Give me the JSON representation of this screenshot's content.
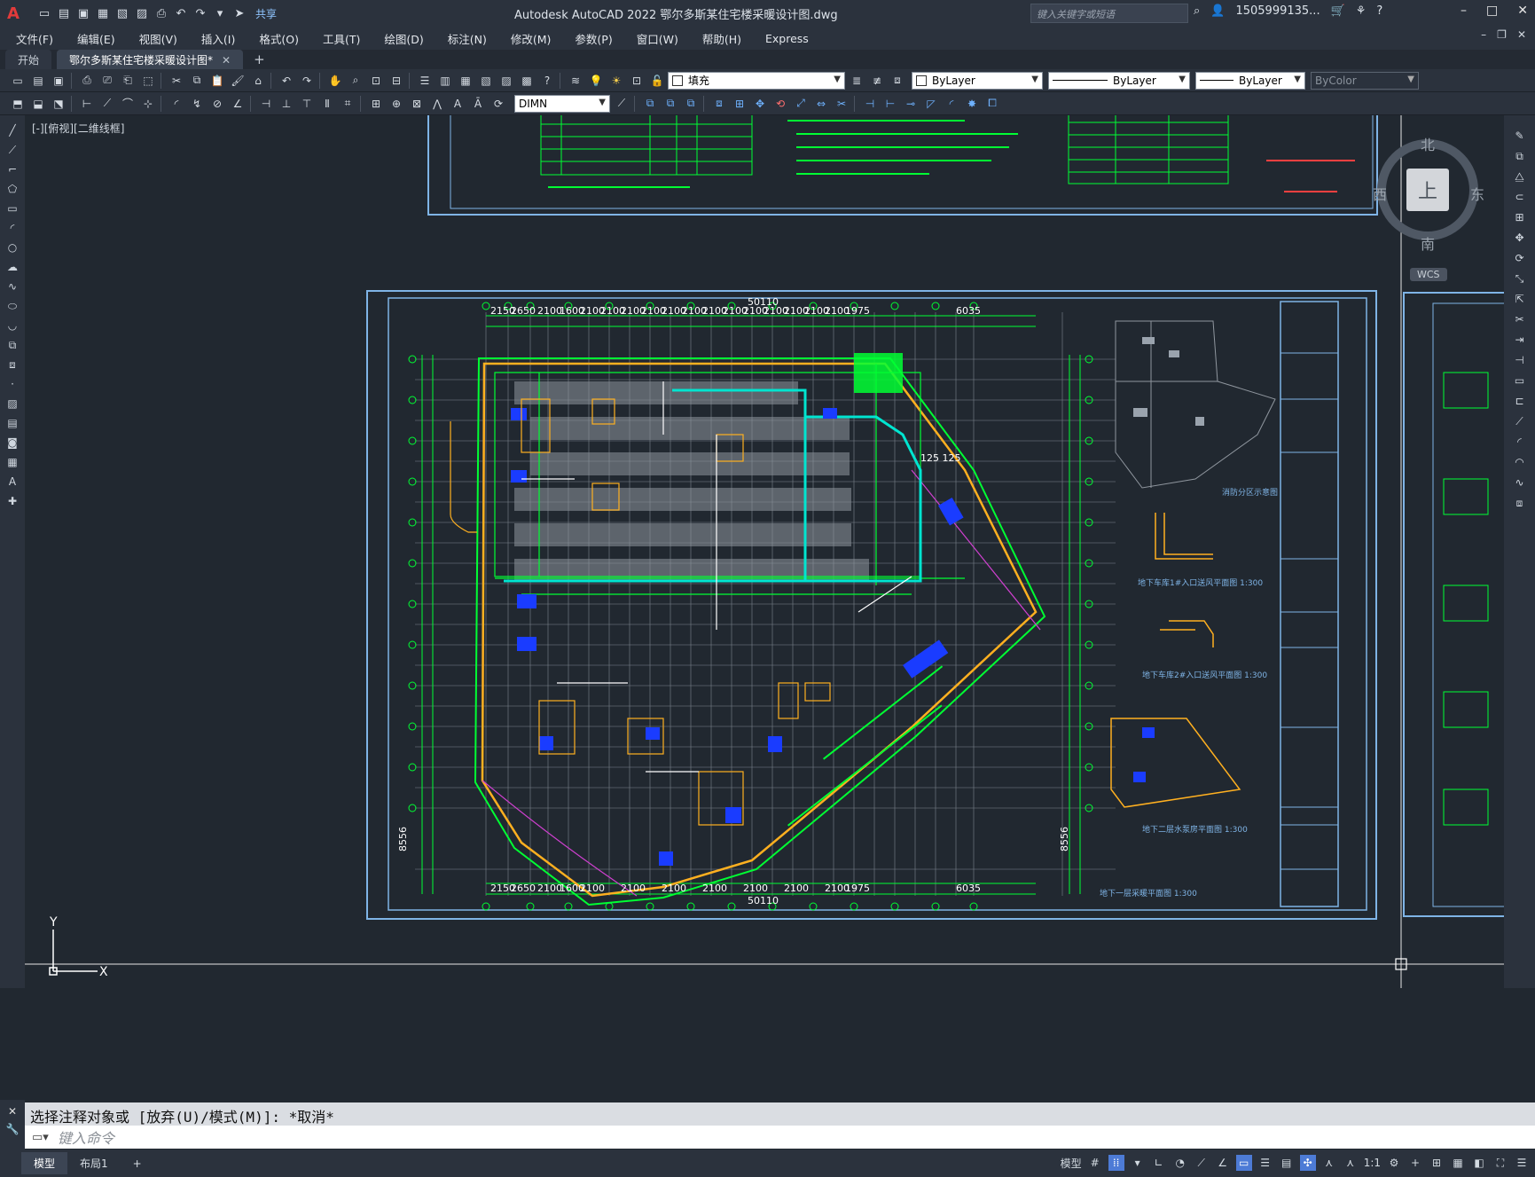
{
  "titlebar": {
    "app_logo": "A",
    "share_label": "共享",
    "title": "Autodesk AutoCAD 2022    鄂尔多斯某住宅楼采暖设计图.dwg",
    "search_placeholder": "键入关键字或短语",
    "user": "1505999135...",
    "controls": [
      "–",
      "□",
      "✕"
    ]
  },
  "menu": {
    "items": [
      "文件(F)",
      "编辑(E)",
      "视图(V)",
      "插入(I)",
      "格式(O)",
      "工具(T)",
      "绘图(D)",
      "标注(N)",
      "修改(M)",
      "参数(P)",
      "窗口(W)",
      "帮助(H)",
      "Express"
    ]
  },
  "tabs": {
    "items": [
      {
        "label": "开始"
      },
      {
        "label": "鄂尔多斯某住宅楼采暖设计图*"
      }
    ],
    "close": "✕",
    "add": "+"
  },
  "properties": {
    "layer": "填充",
    "color": "ByLayer",
    "linetype": "ByLayer",
    "lineweight": "ByLayer",
    "plotstyle": "ByColor",
    "dimstyle": "DIMN"
  },
  "viewport": {
    "label": "[-][俯视][二维线框]",
    "viewcube": {
      "north": "北",
      "south": "南",
      "east": "东",
      "west": "西",
      "top": "上"
    },
    "wcs": "WCS",
    "ucs_y": "Y",
    "ucs_x": "X"
  },
  "drawing_text": {
    "dims_top": [
      "2150",
      "2650",
      "2100",
      "1600",
      "2100",
      "2100",
      "2100",
      "2100",
      "2100",
      "2100",
      "2100",
      "2100",
      "2100",
      "2100",
      "2100",
      "2100",
      "2100",
      "1975",
      "6035"
    ],
    "dim_total": "50110",
    "dim_right": "8556",
    "dim_mid": "125 125",
    "caption_1": "地下车库1#入口送风平面图 1:300",
    "caption_2": "地下车库2#入口送风平面图 1:300",
    "caption_3": "地下二层水泵房平面图 1:300",
    "caption_4": "地下一层采暖平面图 1:300",
    "caption_keyplan": "消防分区示意图"
  },
  "command": {
    "history": "选择注释对象或 [放弃(U)/模式(M)]: *取消*",
    "placeholder": "键入命令"
  },
  "status": {
    "tabs": [
      "模型",
      "布局1"
    ],
    "add": "+",
    "model_label": "模型",
    "scale": "1:1"
  },
  "colors": {
    "bg": "#212830",
    "frame": "#7fb4e6",
    "green": "#00ff33",
    "cyan": "#00e5d0",
    "orange": "#ffb020",
    "blue": "#1a3cff",
    "magenta": "#d040d0"
  }
}
